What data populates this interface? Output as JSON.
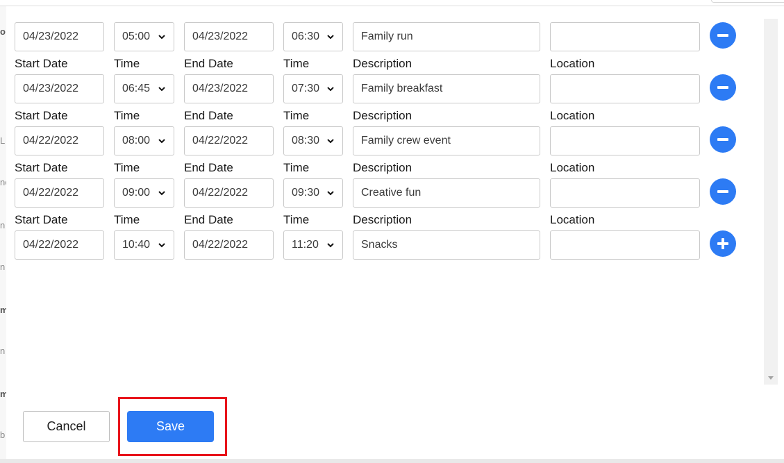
{
  "labels": {
    "start_date": "Start Date",
    "time": "Time",
    "end_date": "End Date",
    "end_time": "Time",
    "description": "Description",
    "location": "Location"
  },
  "events": [
    {
      "start_date": "04/23/2022",
      "start_time": "05:00",
      "end_date": "04/23/2022",
      "end_time": "06:30",
      "description": "Family run",
      "location": "",
      "action": "remove"
    },
    {
      "start_date": "04/23/2022",
      "start_time": "06:45",
      "end_date": "04/23/2022",
      "end_time": "07:30",
      "description": "Family breakfast",
      "location": "",
      "action": "remove"
    },
    {
      "start_date": "04/22/2022",
      "start_time": "08:00",
      "end_date": "04/22/2022",
      "end_time": "08:30",
      "description": "Family crew event",
      "location": "",
      "action": "remove"
    },
    {
      "start_date": "04/22/2022",
      "start_time": "09:00",
      "end_date": "04/22/2022",
      "end_time": "09:30",
      "description": "Creative fun",
      "location": "",
      "action": "remove"
    },
    {
      "start_date": "04/22/2022",
      "start_time": "10:40",
      "end_date": "04/22/2022",
      "end_time": "11:20",
      "description": "Snacks",
      "location": "",
      "action": "add"
    }
  ],
  "footer": {
    "cancel_label": "Cancel",
    "save_label": "Save"
  },
  "background_fragments": [
    "o",
    "L",
    "ne",
    "n",
    "n",
    "m",
    "n",
    "m",
    "b"
  ],
  "colors": {
    "accent": "#2d7bf4",
    "highlight": "#e8141b"
  }
}
